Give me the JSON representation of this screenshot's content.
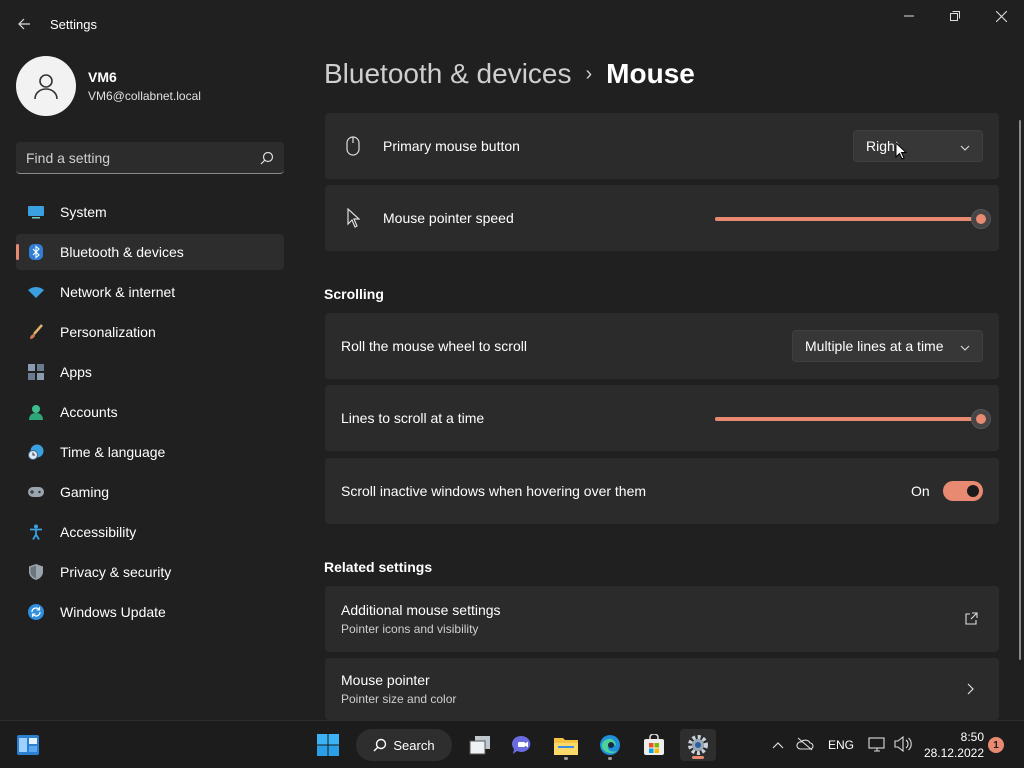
{
  "window": {
    "title": "Settings"
  },
  "profile": {
    "name": "VM6",
    "email": "VM6@collabnet.local"
  },
  "search": {
    "placeholder": "Find a setting"
  },
  "nav": {
    "items": [
      {
        "label": "System",
        "icon": "system-icon"
      },
      {
        "label": "Bluetooth & devices",
        "icon": "bluetooth-icon",
        "active": true
      },
      {
        "label": "Network & internet",
        "icon": "wifi-icon"
      },
      {
        "label": "Personalization",
        "icon": "brush-icon"
      },
      {
        "label": "Apps",
        "icon": "apps-icon"
      },
      {
        "label": "Accounts",
        "icon": "accounts-icon"
      },
      {
        "label": "Time & language",
        "icon": "clock-globe-icon"
      },
      {
        "label": "Gaming",
        "icon": "gamepad-icon"
      },
      {
        "label": "Accessibility",
        "icon": "accessibility-icon"
      },
      {
        "label": "Privacy & security",
        "icon": "shield-icon"
      },
      {
        "label": "Windows Update",
        "icon": "update-icon"
      }
    ]
  },
  "breadcrumb": {
    "parent": "Bluetooth & devices",
    "separator": "›",
    "current": "Mouse"
  },
  "settings": {
    "primary_button": {
      "label": "Primary mouse button",
      "value": "Right",
      "icon": "mouse-icon"
    },
    "pointer_speed": {
      "label": "Mouse pointer speed",
      "icon": "pointer-icon",
      "value_fraction": 1.0
    }
  },
  "scrolling": {
    "title": "Scrolling",
    "roll_wheel": {
      "label": "Roll the mouse wheel to scroll",
      "value": "Multiple lines at a time"
    },
    "lines": {
      "label": "Lines to scroll at a time",
      "value_fraction": 1.0
    },
    "inactive": {
      "label": "Scroll inactive windows when hovering over them",
      "state": "On",
      "on": true
    }
  },
  "related": {
    "title": "Related settings",
    "items": [
      {
        "title": "Additional mouse settings",
        "subtitle": "Pointer icons and visibility",
        "icon": "external-link-icon"
      },
      {
        "title": "Mouse pointer",
        "subtitle": "Pointer size and color",
        "icon": "chevron-right-icon"
      }
    ]
  },
  "taskbar": {
    "search_label": "Search",
    "language": "ENG",
    "time": "8:50",
    "date": "28.12.2022",
    "notification_count": "1"
  },
  "colors": {
    "accent": "#e88a72",
    "background": "#202020",
    "card": "#2b2b2b"
  }
}
